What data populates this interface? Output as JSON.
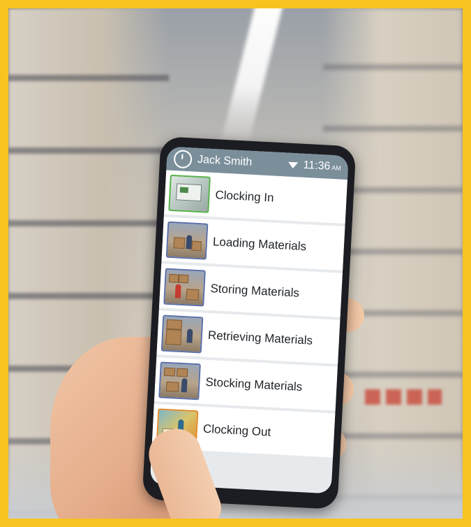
{
  "status_bar": {
    "icon": "clock-icon",
    "user_name": "Jack Smith",
    "signal_icon": "wifi-icon",
    "time": "11:36",
    "ampm": "AM"
  },
  "menu": {
    "items": [
      {
        "label": "Clocking In",
        "icon": "clock-terminal-icon"
      },
      {
        "label": "Loading Materials",
        "icon": "loading-worker-icon"
      },
      {
        "label": "Storing Materials",
        "icon": "storing-worker-icon"
      },
      {
        "label": "Retrieving Materials",
        "icon": "retrieving-worker-icon"
      },
      {
        "label": "Stocking Materials",
        "icon": "stocking-worker-icon"
      },
      {
        "label": "Clocking Out",
        "icon": "clock-out-comic-icon"
      }
    ]
  },
  "colors": {
    "frame": "#f7c321",
    "status_bar": "#7b8f9b",
    "thumb_border_blue": "#5a6fa8",
    "thumb_border_green": "#56b14a",
    "thumb_border_orange": "#e08a2e"
  }
}
